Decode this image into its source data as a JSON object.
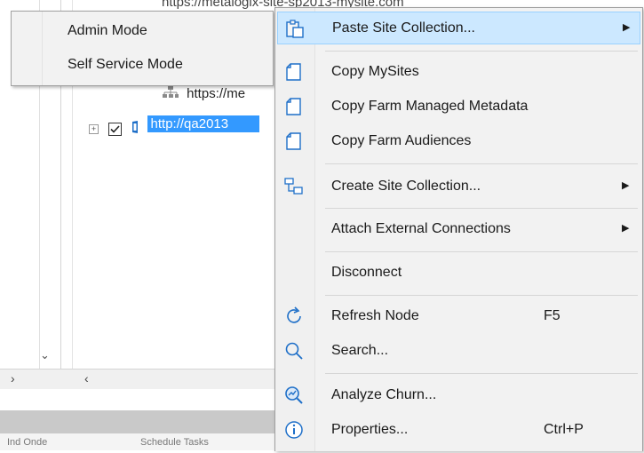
{
  "tree": {
    "top_row_text": "https://metalogix-site-sp2013-mysite.com",
    "https_row_text": "https://me",
    "selected_row_text": "http://qa2013"
  },
  "bottom_strip": {
    "left_text": "Ind Onde",
    "right_text": "Schedule Tasks"
  },
  "mode_menu": {
    "items": [
      {
        "label": "Admin Mode"
      },
      {
        "label": "Self Service Mode"
      }
    ]
  },
  "context_menu": {
    "items": [
      {
        "label": "Paste Site Collection...",
        "icon": "paste-icon",
        "submenu": true,
        "highlighted": true
      },
      {
        "label": "Copy MySites",
        "icon": "copy-icon"
      },
      {
        "label": "Copy Farm Managed Metadata",
        "icon": "copy-icon"
      },
      {
        "label": "Copy Farm Audiences",
        "icon": "copy-icon"
      },
      {
        "label": "Create Site Collection...",
        "icon": "create-site-icon",
        "submenu": true
      },
      {
        "label": "Attach External Connections",
        "submenu": true
      },
      {
        "label": "Disconnect"
      },
      {
        "label": "Refresh Node",
        "icon": "refresh-icon",
        "shortcut": "F5"
      },
      {
        "label": "Search...",
        "icon": "search-icon"
      },
      {
        "label": "Analyze Churn...",
        "icon": "analyze-icon"
      },
      {
        "label": "Properties...",
        "icon": "info-icon",
        "shortcut": "Ctrl+P"
      }
    ],
    "submenu_arrow": "▶"
  },
  "colors": {
    "selection": "#3399ff",
    "menu_highlight": "#cce8ff",
    "icon_blue": "#1e6fc8"
  }
}
